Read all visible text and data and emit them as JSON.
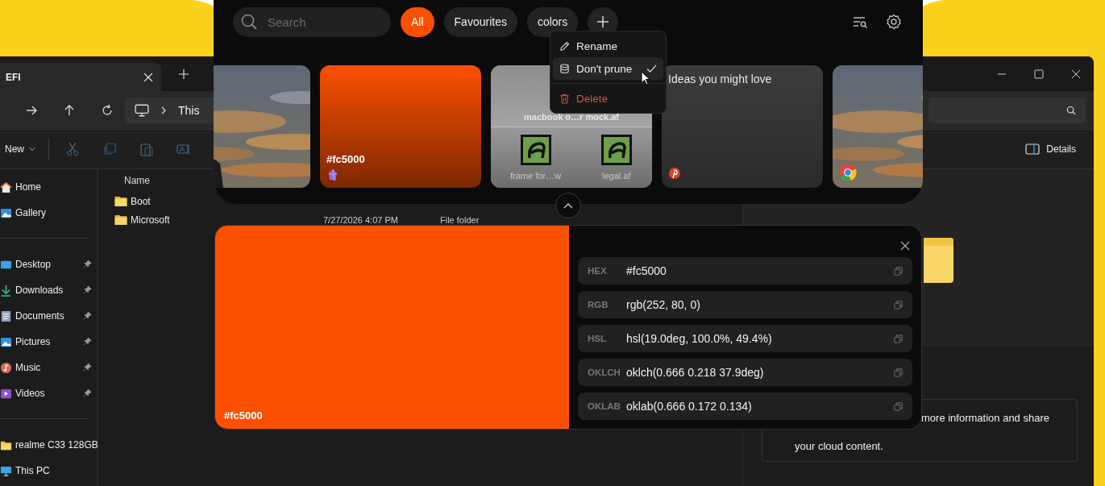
{
  "explorer": {
    "tab": {
      "title": "EFI"
    },
    "address": {
      "segment": "This"
    },
    "toolbar": {
      "new_label": "New",
      "details_label": "Details"
    },
    "sidebar_groups": [
      {
        "items": [
          {
            "label": "Home",
            "pinned": false
          },
          {
            "label": "Gallery",
            "pinned": false
          }
        ]
      },
      {
        "items": [
          {
            "label": "Desktop",
            "pinned": true
          },
          {
            "label": "Downloads",
            "pinned": true
          },
          {
            "label": "Documents",
            "pinned": true
          },
          {
            "label": "Pictures",
            "pinned": true
          },
          {
            "label": "Music",
            "pinned": true
          },
          {
            "label": "Videos",
            "pinned": true
          }
        ]
      },
      {
        "items": [
          {
            "label": "realme C33 128GB",
            "pinned": false
          },
          {
            "label": "This PC",
            "pinned": false
          }
        ]
      }
    ],
    "column_header": "Name",
    "files": [
      {
        "name": "Boot"
      },
      {
        "name": "Microsoft",
        "date": "7/27/2026 4:07 PM",
        "type": "File folder"
      }
    ],
    "details_message": [
      "more information and share",
      "your cloud content."
    ]
  },
  "app": {
    "search": {
      "placeholder": "Search"
    },
    "filters": [
      {
        "label": "All",
        "selected": true
      },
      {
        "label": "Favourites",
        "selected": false
      },
      {
        "label": "colors",
        "selected": false
      }
    ],
    "context_menu": [
      {
        "kind": "rename",
        "label": "Rename",
        "checked": false,
        "selected": false
      },
      {
        "kind": "prune",
        "label": "Don't prune",
        "checked": true,
        "selected": true
      },
      {
        "kind": "delete",
        "label": "Delete",
        "checked": false,
        "selected": false
      }
    ],
    "cards": [
      {
        "kind": "picture"
      },
      {
        "kind": "color",
        "title": "#fc5000",
        "color": "#fc5000"
      },
      {
        "kind": "files",
        "title": "macbook o…r mock.af",
        "files": [
          "frame for…w",
          "legal.af"
        ]
      },
      {
        "kind": "text",
        "title": "Ideas you might love"
      },
      {
        "kind": "picture"
      }
    ]
  },
  "color_panel": {
    "color": "#fc5000",
    "swatch_label": "#fc5000",
    "formats": [
      {
        "label": "HEX",
        "value": "#fc5000"
      },
      {
        "label": "RGB",
        "value": "rgb(252, 80, 0)"
      },
      {
        "label": "HSL",
        "value": "hsl(19.0deg, 100.0%, 49.4%)"
      },
      {
        "label": "OKLCH",
        "value": "oklch(0.666 0.218 37.9deg)"
      },
      {
        "label": "OKLAB",
        "value": "oklab(0.666 0.172 0.134)"
      }
    ]
  }
}
